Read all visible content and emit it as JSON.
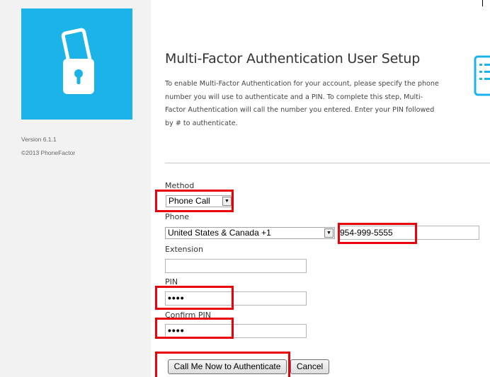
{
  "sidebar": {
    "version": "Version 6.1.1",
    "copyright": "©2013 PhoneFactor",
    "logo_icon": "phone-lock-icon"
  },
  "main": {
    "title": "Multi-Factor Authentication User Setup",
    "intro_lines": [
      "To enable Multi-Factor Authentication for your account, please specify the phone",
      "number you will use to authenticate and a PIN. To complete this step, Multi-",
      "Factor Authentication will call the number you entered. Enter your PIN followed",
      "by # to authenticate."
    ],
    "side_icon": "form-icon"
  },
  "form": {
    "method_label": "Method",
    "method_value": "Phone Call",
    "phone_label": "Phone",
    "country_value": "United States & Canada +1",
    "phone_value": "954-999-5555",
    "extension_label": "Extension",
    "extension_value": "",
    "pin_label": "PIN",
    "pin_value": "••••",
    "confirm_pin_label": "Confirm PIN",
    "confirm_pin_value": "••••",
    "call_button": "Call Me Now to Authenticate",
    "cancel_button": "Cancel"
  },
  "colors": {
    "brand_tile": "#1cb4e8",
    "highlight": "#e8000b"
  }
}
